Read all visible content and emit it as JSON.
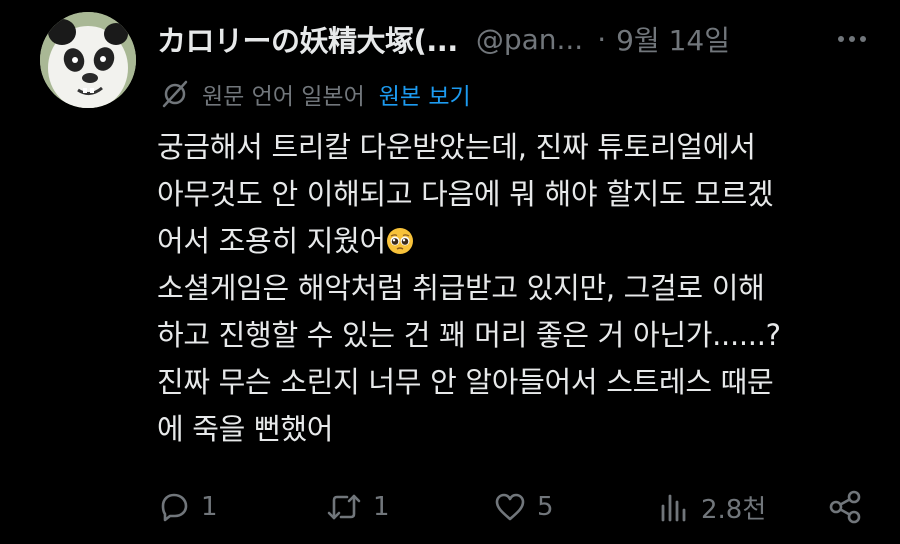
{
  "post": {
    "display_name": "カロリーの妖精大塚(...",
    "handle": "@pan...",
    "separator": "·",
    "date": "9월 14일",
    "translation": {
      "label": "원문 언어 일본어",
      "link": "원본 보기"
    },
    "body_lines": [
      "궁금해서 트리칼 다운받았는데, 진짜 튜토리얼에서",
      "아무것도 안 이해되고 다음에 뭐 해야 할지도 모르겠",
      "어서 조용히 지웠어",
      "소셜게임은 해악처럼 취급받고 있지만, 그걸로 이해",
      "하고 진행할 수 있는 건 꽤 머리 좋은 거 아닌가......?",
      "진짜 무슨 소린지 너무 안 알아들어서 스트레스 때문",
      "에 죽을 뻔했어"
    ],
    "emoji": "pleading-face"
  },
  "actions": {
    "reply_count": "1",
    "repost_count": "1",
    "like_count": "5",
    "views_count": "2.8천"
  },
  "icons": {
    "avatar": "panda-avatar",
    "translate": "translate-slash-icon",
    "more": "more-horizontal-icon",
    "reply": "reply-icon",
    "repost": "repost-icon",
    "like": "heart-icon",
    "views": "views-bar-icon",
    "share": "share-icon"
  },
  "colors": {
    "background": "#000000",
    "text": "#e7e9ea",
    "muted": "#71767b",
    "link": "#1d9bf0"
  }
}
